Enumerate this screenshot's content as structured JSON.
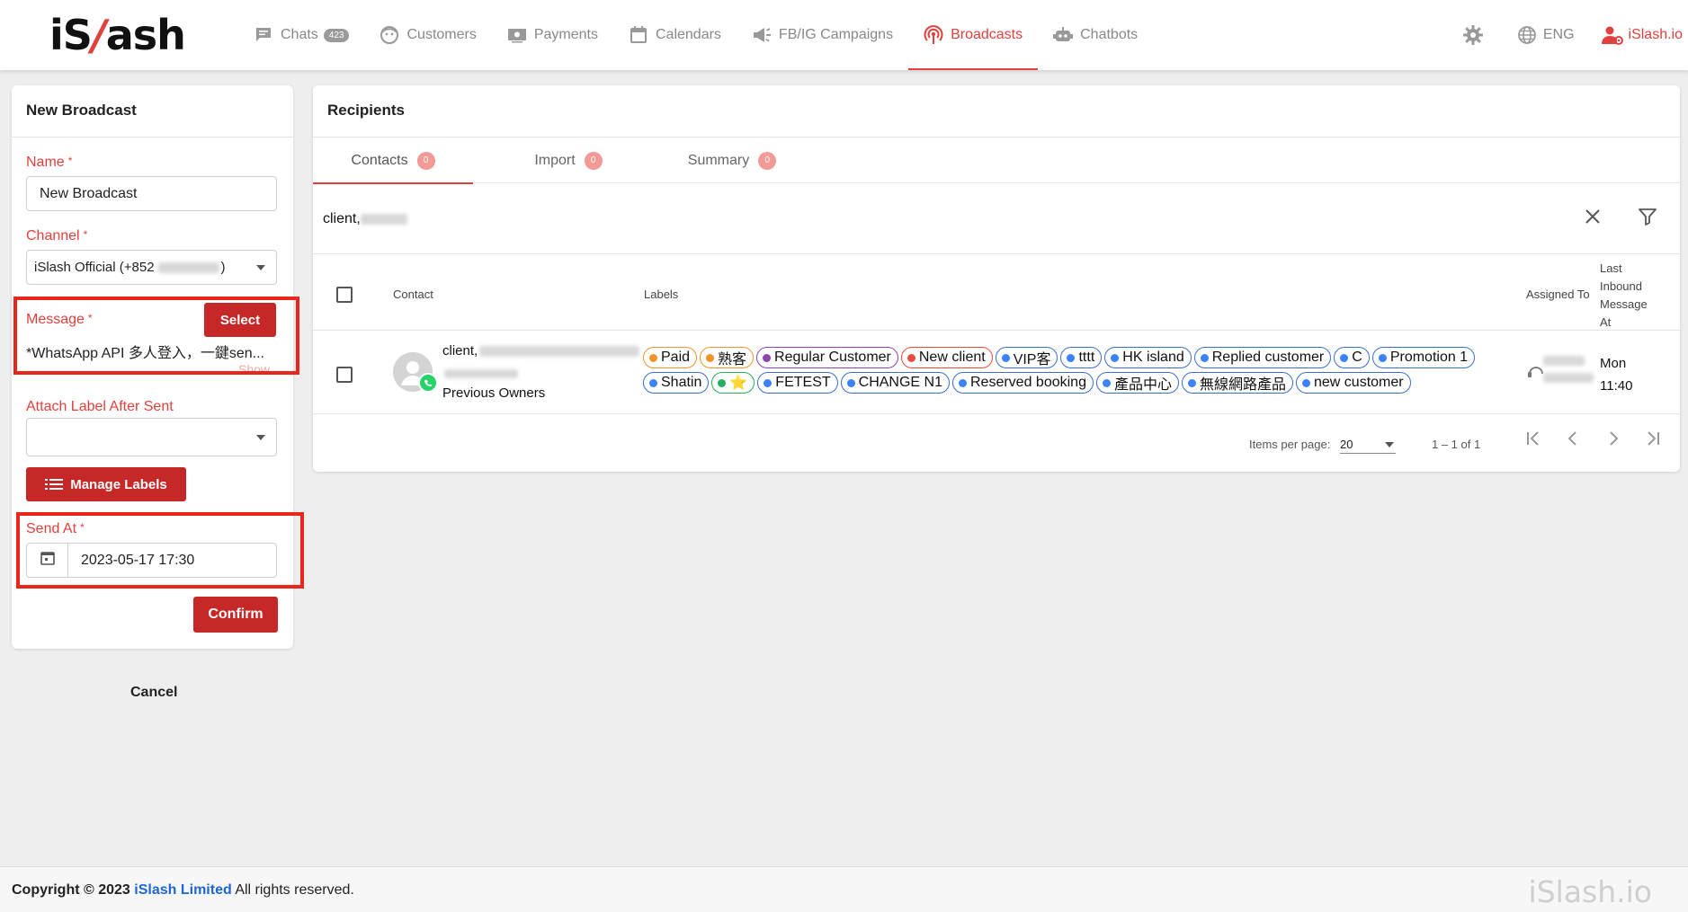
{
  "brand": {
    "logo_left": "iS",
    "logo_slash": "/",
    "logo_right": "ash"
  },
  "nav": {
    "items": [
      {
        "label": "Chats",
        "badge": "423",
        "icon": "chat-icon"
      },
      {
        "label": "Customers",
        "icon": "customer-icon"
      },
      {
        "label": "Payments",
        "icon": "payment-icon"
      },
      {
        "label": "Calendars",
        "icon": "calendar-icon"
      },
      {
        "label": "FB/IG Campaigns",
        "icon": "megaphone-icon"
      },
      {
        "label": "Broadcasts",
        "icon": "broadcast-icon",
        "active": true
      },
      {
        "label": "Chatbots",
        "icon": "robot-icon"
      }
    ],
    "language": "ENG",
    "user": "iSlash.io"
  },
  "broadcast_form": {
    "title": "New Broadcast",
    "name_label": "Name",
    "name_value": "New Broadcast",
    "channel_label": "Channel",
    "channel_value": "iSlash Official (+852",
    "channel_suffix": ")",
    "message_label": "Message",
    "select_button": "Select",
    "message_value": "*WhatsApp API 多人登入，一鍵sen...",
    "show_link": "Show",
    "attach_label": "Attach Label After Sent",
    "attach_value": "",
    "manage_labels_button": "Manage Labels",
    "send_at_label": "Send At",
    "send_at_value": "2023-05-17 17:30",
    "cancel_button": "Cancel",
    "confirm_button": "Confirm",
    "required_mark": "*"
  },
  "recipients": {
    "title": "Recipients",
    "tabs": [
      {
        "label": "Contacts",
        "count": "0"
      },
      {
        "label": "Import",
        "count": "0"
      },
      {
        "label": "Summary",
        "count": "0"
      }
    ],
    "search_value": "client,",
    "columns": {
      "contact": "Contact",
      "labels": "Labels",
      "assigned_to": "Assigned To",
      "last_inbound": "Last Inbound Message At"
    },
    "row": {
      "contact_name_prefix": "client,",
      "contact_note": "Previous Owners",
      "last_inbound_day": "Mon",
      "last_inbound_time": "11:40",
      "labels": [
        {
          "text": "Paid",
          "dot": "#f0932b",
          "border": "#f0932b"
        },
        {
          "text": "熟客",
          "dot": "#f0932b",
          "border": "#f0932b"
        },
        {
          "text": "Regular Customer",
          "dot": "#8e44ad",
          "border": "#8e44ad"
        },
        {
          "text": "New client",
          "dot": "#e74c3c",
          "border": "#e74c3c"
        },
        {
          "text": "VIP客",
          "dot": "#3b82f6",
          "border": "#3b6fc9"
        },
        {
          "text": "tttt",
          "dot": "#3b82f6",
          "border": "#3b6fc9"
        },
        {
          "text": "HK island",
          "dot": "#3b82f6",
          "border": "#3b6fc9"
        },
        {
          "text": "Replied customer",
          "dot": "#3b82f6",
          "border": "#3b6fc9"
        },
        {
          "text": "C",
          "dot": "#3b82f6",
          "border": "#3b6fc9"
        },
        {
          "text": "Promotion 1",
          "dot": "#3b82f6",
          "border": "#3b6fc9"
        },
        {
          "text": "Shatin",
          "dot": "#3b82f6",
          "border": "#3b6fc9"
        },
        {
          "text": "⭐",
          "dot": "#27ae60",
          "border": "#27ae60"
        },
        {
          "text": "FETEST",
          "dot": "#3b82f6",
          "border": "#3b6fc9"
        },
        {
          "text": "CHANGE N1",
          "dot": "#3b82f6",
          "border": "#3b6fc9"
        },
        {
          "text": "Reserved booking",
          "dot": "#3b82f6",
          "border": "#3b6fc9"
        },
        {
          "text": "產品中心",
          "dot": "#3b82f6",
          "border": "#3b6fc9"
        },
        {
          "text": "無線網路產品",
          "dot": "#3b82f6",
          "border": "#3b6fc9"
        },
        {
          "text": "new customer",
          "dot": "#3b82f6",
          "border": "#3b6fc9"
        }
      ]
    },
    "pagination": {
      "items_per_page_label": "Items per page:",
      "items_per_page": "20",
      "range": "1 – 1 of 1"
    }
  },
  "footer": {
    "copyright": "Copyright © 2023",
    "company": "iSlash Limited",
    "rights": "All rights reserved.",
    "brand": "iSlash.io"
  },
  "colors": {
    "accent": "#e0413d",
    "button_red": "#c62828",
    "highlight": "#e8261c",
    "link_blue": "#1e66d0"
  }
}
